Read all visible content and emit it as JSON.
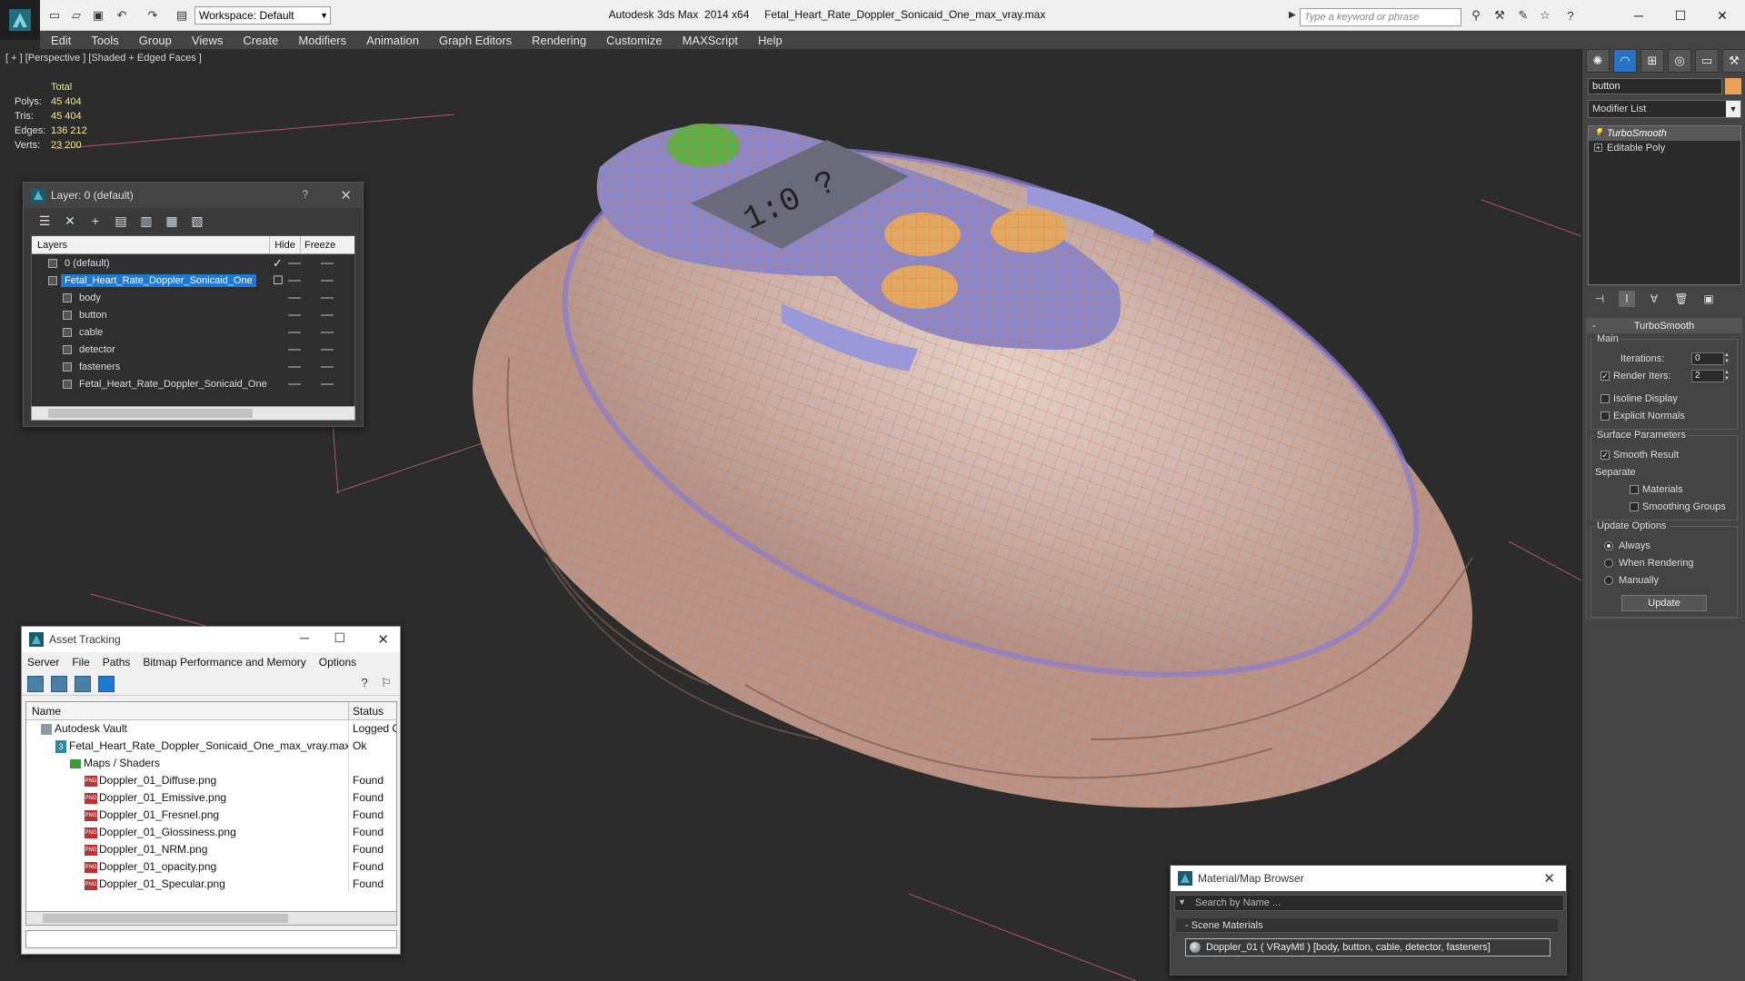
{
  "titlebar": {
    "workspace": "Workspace: Default",
    "title": "Autodesk 3ds Max  2014 x64     Fetal_Heart_Rate_Doppler_Sonicaid_One_max_vray.max",
    "search_placeholder": "Type a keyword or phrase"
  },
  "menu": [
    "Edit",
    "Tools",
    "Group",
    "Views",
    "Create",
    "Modifiers",
    "Animation",
    "Graph Editors",
    "Rendering",
    "Customize",
    "MAXScript",
    "Help"
  ],
  "viewport": {
    "label": "[ + ] [Perspective ] [Shaded + Edged Faces ]",
    "stats": {
      "total_label": "Total",
      "rows": [
        {
          "label": "Polys:",
          "value": "45 404"
        },
        {
          "label": "Tris:",
          "value": "45 404"
        },
        {
          "label": "Edges:",
          "value": "136 212"
        },
        {
          "label": "Verts:",
          "value": "23 200"
        }
      ]
    },
    "device_text": "1:0 ?"
  },
  "layer_panel": {
    "title": "Layer: 0 (default)",
    "help": "?",
    "columns": [
      "Layers",
      "Hide",
      "Freeze"
    ],
    "rows": [
      {
        "name": "0 (default)",
        "level": 0,
        "checked": true,
        "selected": false
      },
      {
        "name": "Fetal_Heart_Rate_Doppler_Sonicaid_One",
        "level": 0,
        "checked": false,
        "selected": true
      },
      {
        "name": "body",
        "level": 1,
        "checked": false,
        "selected": false
      },
      {
        "name": "button",
        "level": 1,
        "checked": false,
        "selected": false
      },
      {
        "name": "cable",
        "level": 1,
        "checked": false,
        "selected": false
      },
      {
        "name": "detector",
        "level": 1,
        "checked": false,
        "selected": false
      },
      {
        "name": "fasteners",
        "level": 1,
        "checked": false,
        "selected": false
      },
      {
        "name": "Fetal_Heart_Rate_Doppler_Sonicaid_One",
        "level": 1,
        "checked": false,
        "selected": false
      }
    ]
  },
  "asset_panel": {
    "title": "Asset Tracking",
    "menu": [
      "Server",
      "File",
      "Paths",
      "Bitmap Performance and Memory",
      "Options"
    ],
    "columns": [
      "Name",
      "Status"
    ],
    "rows": [
      {
        "name": "Autodesk Vault",
        "status": "Logged C",
        "icon": "vault",
        "indent": 1
      },
      {
        "name": "Fetal_Heart_Rate_Doppler_Sonicaid_One_max_vray.max",
        "status": "Ok",
        "icon": "max",
        "indent": 2
      },
      {
        "name": "Maps / Shaders",
        "status": "",
        "icon": "folder",
        "indent": 3
      },
      {
        "name": "Doppler_01_Diffuse.png",
        "status": "Found",
        "icon": "png",
        "indent": 4
      },
      {
        "name": "Doppler_01_Emissive.png",
        "status": "Found",
        "icon": "png",
        "indent": 4
      },
      {
        "name": "Doppler_01_Fresnel.png",
        "status": "Found",
        "icon": "png",
        "indent": 4
      },
      {
        "name": "Doppler_01_Glossiness.png",
        "status": "Found",
        "icon": "png",
        "indent": 4
      },
      {
        "name": "Doppler_01_NRM.png",
        "status": "Found",
        "icon": "png",
        "indent": 4
      },
      {
        "name": "Doppler_01_opacity.png",
        "status": "Found",
        "icon": "png",
        "indent": 4
      },
      {
        "name": "Doppler_01_Specular.png",
        "status": "Found",
        "icon": "png",
        "indent": 4
      }
    ]
  },
  "material_browser": {
    "title": "Material/Map Browser",
    "search_placeholder": "Search by Name ...",
    "section": "- Scene Materials",
    "item": "Doppler_01  ( VRayMtl )  [body, button, cable, detector, fasteners]"
  },
  "command_panel": {
    "object_name": "button",
    "object_color": "#e9a15a",
    "modifier_list": "Modifier List",
    "stack": [
      "TurboSmooth",
      "Editable Poly"
    ],
    "rollout_title": "TurboSmooth",
    "main_group": "Main",
    "iterations_label": "Iterations:",
    "iterations_value": "0",
    "render_iters_label": "Render Iters:",
    "render_iters_value": "2",
    "isoline_label": "Isoline Display",
    "explicit_label": "Explicit Normals",
    "surface_group": "Surface Parameters",
    "smooth_result_label": "Smooth Result",
    "separate_label": "Separate",
    "materials_label": "Materials",
    "smoothing_label": "Smoothing Groups",
    "update_group": "Update Options",
    "always_label": "Always",
    "when_rendering_label": "When Rendering",
    "manually_label": "Manually",
    "update_button": "Update"
  },
  "colors": {
    "accent": "#1e78d6",
    "wire": "#e06a2a",
    "body": "#c9a89a",
    "panel_face": "#8a88c8"
  }
}
